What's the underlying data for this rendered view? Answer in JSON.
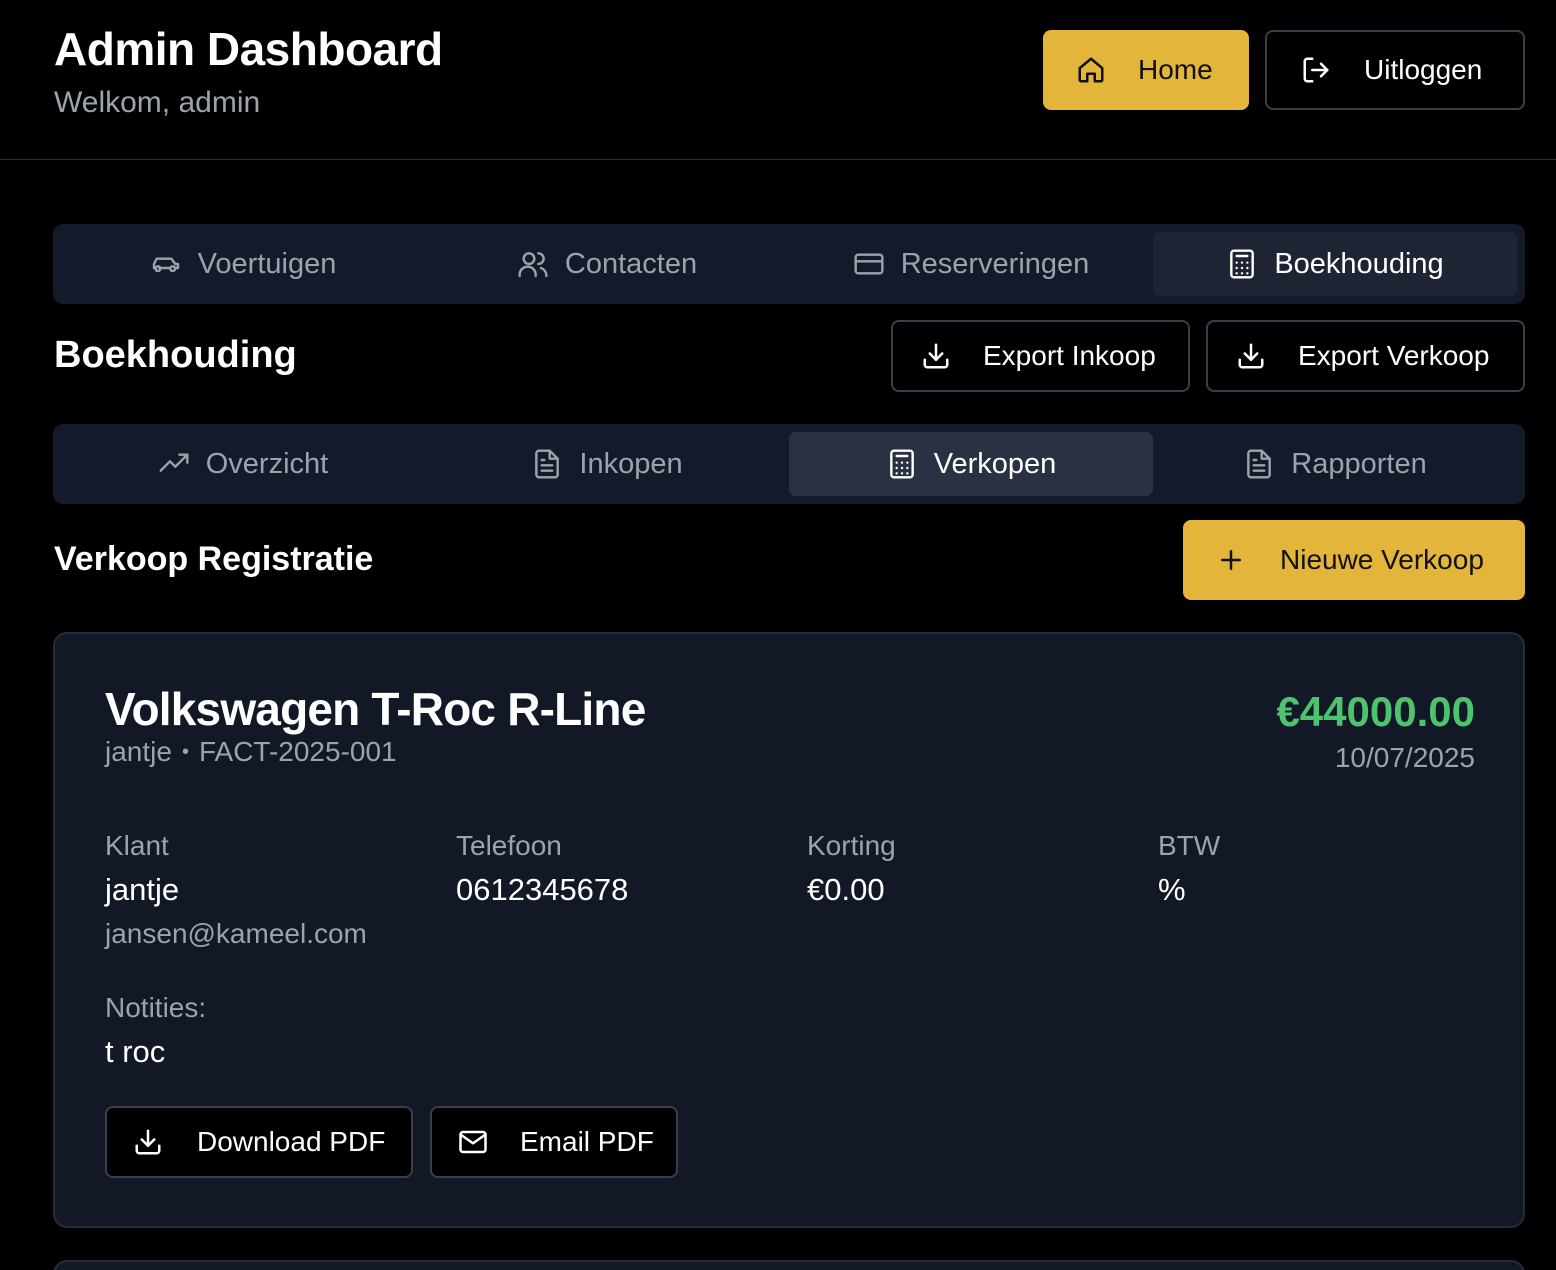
{
  "header": {
    "title": "Admin Dashboard",
    "subtitle": "Welkom, admin",
    "home_label": "Home",
    "logout_label": "Uitloggen"
  },
  "main_tabs": [
    {
      "label": "Voertuigen",
      "icon": "car-icon",
      "active": false
    },
    {
      "label": "Contacten",
      "icon": "users-icon",
      "active": false
    },
    {
      "label": "Reserveringen",
      "icon": "credit-card-icon",
      "active": false
    },
    {
      "label": "Boekhouding",
      "icon": "calculator-icon",
      "active": true
    }
  ],
  "section": {
    "title": "Boekhouding",
    "export_inkoop_label": "Export Inkoop",
    "export_verkoop_label": "Export Verkoop"
  },
  "sub_tabs": [
    {
      "label": "Overzicht",
      "icon": "trending-up-icon",
      "active": false
    },
    {
      "label": "Inkopen",
      "icon": "file-text-icon",
      "active": false
    },
    {
      "label": "Verkopen",
      "icon": "calculator-icon",
      "active": true
    },
    {
      "label": "Rapporten",
      "icon": "file-text-icon",
      "active": false
    }
  ],
  "sales": {
    "title": "Verkoop Registratie",
    "new_label": "Nieuwe Verkoop"
  },
  "sale": {
    "vehicle": "Volkswagen T-Roc R-Line",
    "seller": "jantje",
    "separator": "•",
    "invoice": "FACT-2025-001",
    "price": "€44000.00",
    "date": "10/07/2025",
    "klant_label": "Klant",
    "klant_name": "jantje",
    "klant_email": "jansen@kameel.com",
    "telefoon_label": "Telefoon",
    "telefoon": "0612345678",
    "korting_label": "Korting",
    "korting": "€0.00",
    "btw_label": "BTW",
    "btw": "%",
    "notes_label": "Notities:",
    "notes": "t roc",
    "download_label": "Download PDF",
    "email_label": "Email PDF"
  },
  "colors": {
    "accent": "#e3b53a",
    "price_green": "#4ec36e",
    "card_bg": "#121826",
    "tabbar_bg": "#141a29"
  }
}
